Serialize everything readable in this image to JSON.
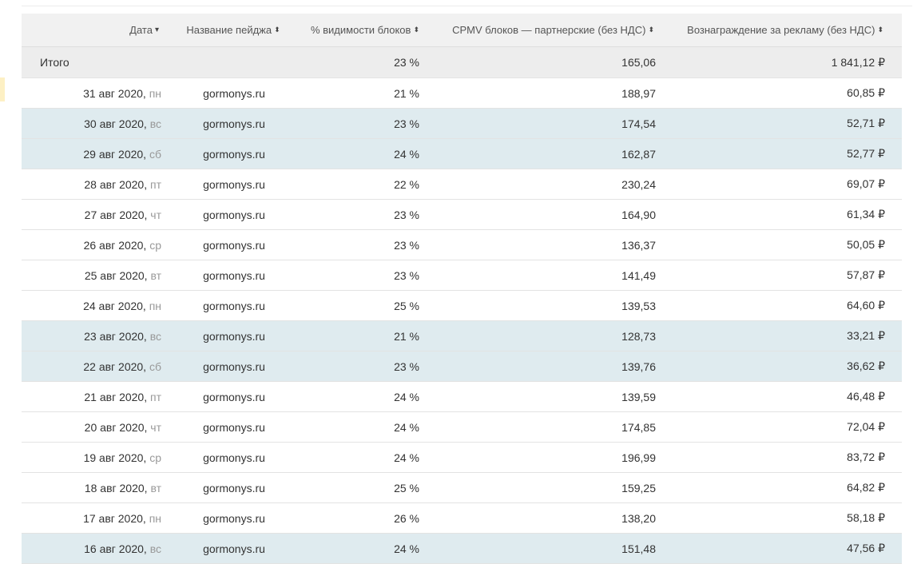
{
  "columns": {
    "date": "Дата",
    "page": "Название пейджа",
    "visibility": "% видимости блоков",
    "cpmv": "CPMV блоков — партнерские (без НДС)",
    "reward": "Вознаграждение за рекламу (без НДС)"
  },
  "icons": {
    "sort_desc": "▾",
    "sort_both": "⬍"
  },
  "total": {
    "label": "Итого",
    "visibility": "23 %",
    "cpmv": "165,06",
    "reward": "1 841,12 ₽"
  },
  "rows": [
    {
      "date": "31 авг 2020,",
      "dow": "пн",
      "page": "gormonys.ru",
      "visibility": "21 %",
      "cpmv": "188,97",
      "reward": "60,85 ₽"
    },
    {
      "date": "30 авг 2020,",
      "dow": "вс",
      "page": "gormonys.ru",
      "visibility": "23 %",
      "cpmv": "174,54",
      "reward": "52,71 ₽"
    },
    {
      "date": "29 авг 2020,",
      "dow": "сб",
      "page": "gormonys.ru",
      "visibility": "24 %",
      "cpmv": "162,87",
      "reward": "52,77 ₽"
    },
    {
      "date": "28 авг 2020,",
      "dow": "пт",
      "page": "gormonys.ru",
      "visibility": "22 %",
      "cpmv": "230,24",
      "reward": "69,07 ₽"
    },
    {
      "date": "27 авг 2020,",
      "dow": "чт",
      "page": "gormonys.ru",
      "visibility": "23 %",
      "cpmv": "164,90",
      "reward": "61,34 ₽"
    },
    {
      "date": "26 авг 2020,",
      "dow": "ср",
      "page": "gormonys.ru",
      "visibility": "23 %",
      "cpmv": "136,37",
      "reward": "50,05 ₽"
    },
    {
      "date": "25 авг 2020,",
      "dow": "вт",
      "page": "gormonys.ru",
      "visibility": "23 %",
      "cpmv": "141,49",
      "reward": "57,87 ₽"
    },
    {
      "date": "24 авг 2020,",
      "dow": "пн",
      "page": "gormonys.ru",
      "visibility": "25 %",
      "cpmv": "139,53",
      "reward": "64,60 ₽"
    },
    {
      "date": "23 авг 2020,",
      "dow": "вс",
      "page": "gormonys.ru",
      "visibility": "21 %",
      "cpmv": "128,73",
      "reward": "33,21 ₽"
    },
    {
      "date": "22 авг 2020,",
      "dow": "сб",
      "page": "gormonys.ru",
      "visibility": "23 %",
      "cpmv": "139,76",
      "reward": "36,62 ₽"
    },
    {
      "date": "21 авг 2020,",
      "dow": "пт",
      "page": "gormonys.ru",
      "visibility": "24 %",
      "cpmv": "139,59",
      "reward": "46,48 ₽"
    },
    {
      "date": "20 авг 2020,",
      "dow": "чт",
      "page": "gormonys.ru",
      "visibility": "24 %",
      "cpmv": "174,85",
      "reward": "72,04 ₽"
    },
    {
      "date": "19 авг 2020,",
      "dow": "ср",
      "page": "gormonys.ru",
      "visibility": "24 %",
      "cpmv": "196,99",
      "reward": "83,72 ₽"
    },
    {
      "date": "18 авг 2020,",
      "dow": "вт",
      "page": "gormonys.ru",
      "visibility": "25 %",
      "cpmv": "159,25",
      "reward": "64,82 ₽"
    },
    {
      "date": "17 авг 2020,",
      "dow": "пн",
      "page": "gormonys.ru",
      "visibility": "26 %",
      "cpmv": "138,20",
      "reward": "58,18 ₽"
    },
    {
      "date": "16 авг 2020,",
      "dow": "вс",
      "page": "gormonys.ru",
      "visibility": "24 %",
      "cpmv": "151,48",
      "reward": "47,56 ₽"
    }
  ],
  "colors": {
    "weekend_row": "#dfebef",
    "header_bg": "#f1f1f1",
    "total_bg": "#ededed",
    "marker": "#fdf0c4"
  }
}
